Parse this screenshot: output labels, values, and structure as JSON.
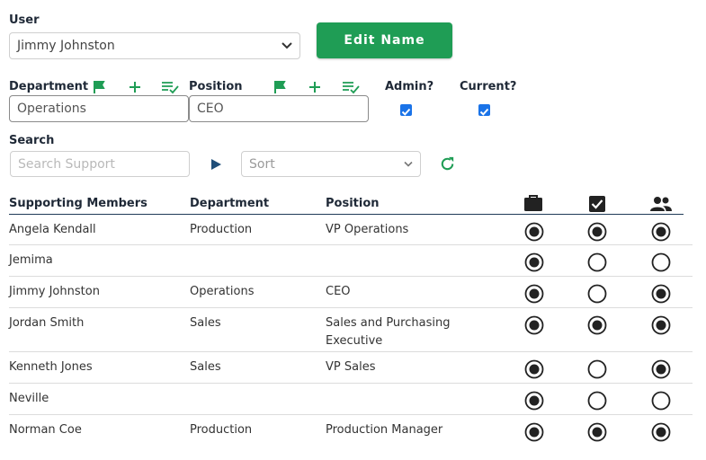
{
  "user": {
    "label": "User",
    "selected": "Jimmy Johnston"
  },
  "edit_button": "Edit Name",
  "department": {
    "label": "Department",
    "value": "Operations"
  },
  "position": {
    "label": "Position",
    "value": "CEO"
  },
  "admin": {
    "label": "Admin?",
    "checked": true
  },
  "current": {
    "label": "Current?",
    "checked": true
  },
  "search": {
    "label": "Search",
    "placeholder": "Search Support",
    "sort_placeholder": "Sort"
  },
  "table": {
    "headers": {
      "name": "Supporting Members",
      "department": "Department",
      "position": "Position"
    },
    "header_icons": [
      "briefcase-icon",
      "checkbox-icon",
      "people-icon"
    ],
    "rows": [
      {
        "name": "Angela Kendall",
        "department": "Production",
        "position": "VP Operations",
        "r1": true,
        "r2": true,
        "r3": true
      },
      {
        "name": "Jemima",
        "department": "",
        "position": "",
        "r1": true,
        "r2": false,
        "r3": false
      },
      {
        "name": "Jimmy Johnston",
        "department": "Operations",
        "position": "CEO",
        "r1": true,
        "r2": false,
        "r3": true
      },
      {
        "name": "Jordan Smith",
        "department": "Sales",
        "position": "Sales and Purchasing Executive",
        "r1": true,
        "r2": true,
        "r3": true
      },
      {
        "name": "Kenneth Jones",
        "department": "Sales",
        "position": "VP Sales",
        "r1": true,
        "r2": false,
        "r3": true
      },
      {
        "name": "Neville",
        "department": "",
        "position": "",
        "r1": true,
        "r2": false,
        "r3": false
      },
      {
        "name": "Norman Coe",
        "department": "Production",
        "position": "Production Manager",
        "r1": true,
        "r2": true,
        "r3": true
      }
    ]
  },
  "colors": {
    "accent_green": "#1f9d55",
    "checkbox_blue": "#1a73e8",
    "play_blue": "#1f4e79"
  }
}
